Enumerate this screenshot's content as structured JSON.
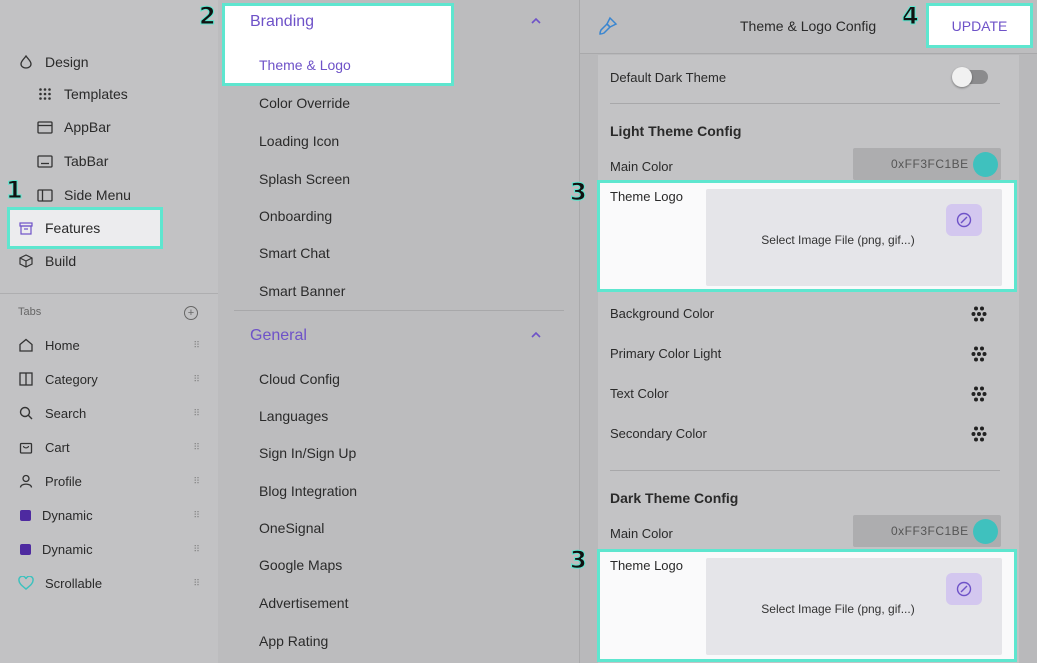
{
  "sidebar": {
    "design": "Design",
    "templates": "Templates",
    "appbar": "AppBar",
    "tabbar": "TabBar",
    "side_menu": "Side Menu",
    "features": "Features",
    "build": "Build",
    "tabs_header": "Tabs",
    "tabs": [
      {
        "label": "Home"
      },
      {
        "label": "Category"
      },
      {
        "label": "Search"
      },
      {
        "label": "Cart"
      },
      {
        "label": "Profile"
      },
      {
        "label": "Dynamic"
      },
      {
        "label": "Dynamic"
      },
      {
        "label": "Scrollable"
      }
    ]
  },
  "middle": {
    "branding": {
      "title": "Branding",
      "items": [
        "Theme & Logo",
        "Color Override",
        "Loading Icon",
        "Splash Screen",
        "Onboarding",
        "Smart Chat",
        "Smart Banner"
      ]
    },
    "general": {
      "title": "General",
      "items": [
        "Cloud Config",
        "Languages",
        "Sign In/Sign Up",
        "Blog Integration",
        "OneSignal",
        "Google Maps",
        "Advertisement",
        "App Rating"
      ]
    }
  },
  "right": {
    "header_title": "Theme & Logo Config",
    "update_label": "UPDATE",
    "default_dark_theme": "Default Dark Theme",
    "light_section": "Light Theme Config",
    "dark_section": "Dark Theme Config",
    "main_color_label": "Main Color",
    "main_color_value": "0xFF3FC1BE",
    "theme_logo_label": "Theme Logo",
    "select_image": "Select Image File (png, gif...)",
    "color_rows": [
      "Background Color",
      "Primary Color Light",
      "Text Color",
      "Secondary Color"
    ]
  },
  "annotations": [
    "1",
    "2",
    "3",
    "3",
    "4"
  ],
  "colors": {
    "accent": "#6e52c8",
    "highlight": "#5ee6cf",
    "swatch": "#3fc1be",
    "dynamic_tab": "#4e2aa0"
  }
}
